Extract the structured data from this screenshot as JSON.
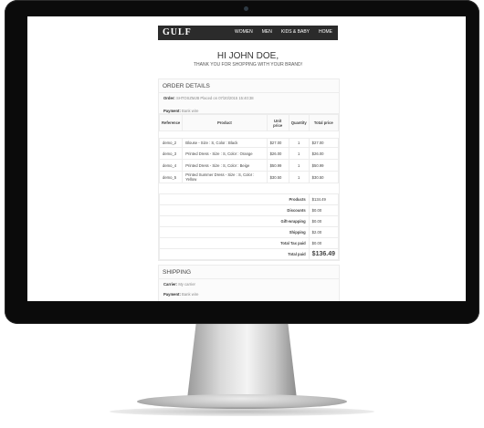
{
  "header": {
    "logo": "GULF",
    "nav": [
      "WOMEN",
      "MEN",
      "KIDS & BABY",
      "HOME"
    ]
  },
  "greeting": {
    "title": "HI JOHN DOE,",
    "subtitle": "THANK YOU FOR SHOPPING WITH YOUR BRAND!"
  },
  "order": {
    "section_title": "ORDER DETAILS",
    "order_label": "Order:",
    "order_value": "SHTOSZMJB Placed on 07/20/2015 15:40:38",
    "payment_label": "Payment:",
    "payment_value": "Bank wire"
  },
  "table": {
    "headers": [
      "Reference",
      "Product",
      "Unit price",
      "Quantity",
      "Total price"
    ],
    "rows": [
      {
        "ref": "demo_2",
        "product": "Blouse - Size : S, Color : Black",
        "unit": "$27.00",
        "qty": "1",
        "total": "$27.00"
      },
      {
        "ref": "demo_3",
        "product": "Printed Dress - Size : S, Color : Orange",
        "unit": "$26.00",
        "qty": "1",
        "total": "$26.00"
      },
      {
        "ref": "demo_4",
        "product": "Printed Dress - Size : S, Color : Beige",
        "unit": "$50.99",
        "qty": "1",
        "total": "$50.99"
      },
      {
        "ref": "demo_5",
        "product": "Printed Summer Dress - Size : S, Color : Yellow",
        "unit": "$30.50",
        "qty": "1",
        "total": "$30.50"
      }
    ],
    "totals": [
      {
        "label": "Products",
        "value": "$134.49"
      },
      {
        "label": "Discounts",
        "value": "$0.00"
      },
      {
        "label": "Gift-wrapping",
        "value": "$0.00"
      },
      {
        "label": "Shipping",
        "value": "$2.00"
      },
      {
        "label": "Total Tax paid",
        "value": "$0.00"
      },
      {
        "label": "Total paid",
        "value": "$136.49"
      }
    ]
  },
  "shipping": {
    "section_title": "SHIPPING",
    "carrier_label": "Carrier:",
    "carrier_value": "My carrier",
    "payment_label": "Payment:",
    "payment_value": "Bank wire"
  }
}
